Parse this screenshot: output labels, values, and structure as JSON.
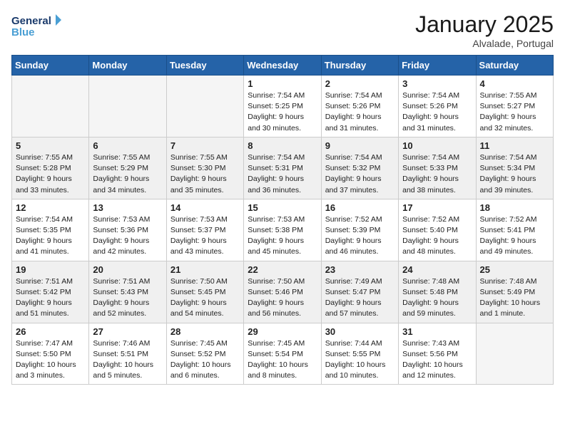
{
  "logo": {
    "line1": "General",
    "line2": "Blue"
  },
  "title": "January 2025",
  "location": "Alvalade, Portugal",
  "weekdays": [
    "Sunday",
    "Monday",
    "Tuesday",
    "Wednesday",
    "Thursday",
    "Friday",
    "Saturday"
  ],
  "weeks": [
    [
      {
        "day": "",
        "info": ""
      },
      {
        "day": "",
        "info": ""
      },
      {
        "day": "",
        "info": ""
      },
      {
        "day": "1",
        "info": "Sunrise: 7:54 AM\nSunset: 5:25 PM\nDaylight: 9 hours\nand 30 minutes."
      },
      {
        "day": "2",
        "info": "Sunrise: 7:54 AM\nSunset: 5:26 PM\nDaylight: 9 hours\nand 31 minutes."
      },
      {
        "day": "3",
        "info": "Sunrise: 7:54 AM\nSunset: 5:26 PM\nDaylight: 9 hours\nand 31 minutes."
      },
      {
        "day": "4",
        "info": "Sunrise: 7:55 AM\nSunset: 5:27 PM\nDaylight: 9 hours\nand 32 minutes."
      }
    ],
    [
      {
        "day": "5",
        "info": "Sunrise: 7:55 AM\nSunset: 5:28 PM\nDaylight: 9 hours\nand 33 minutes."
      },
      {
        "day": "6",
        "info": "Sunrise: 7:55 AM\nSunset: 5:29 PM\nDaylight: 9 hours\nand 34 minutes."
      },
      {
        "day": "7",
        "info": "Sunrise: 7:55 AM\nSunset: 5:30 PM\nDaylight: 9 hours\nand 35 minutes."
      },
      {
        "day": "8",
        "info": "Sunrise: 7:54 AM\nSunset: 5:31 PM\nDaylight: 9 hours\nand 36 minutes."
      },
      {
        "day": "9",
        "info": "Sunrise: 7:54 AM\nSunset: 5:32 PM\nDaylight: 9 hours\nand 37 minutes."
      },
      {
        "day": "10",
        "info": "Sunrise: 7:54 AM\nSunset: 5:33 PM\nDaylight: 9 hours\nand 38 minutes."
      },
      {
        "day": "11",
        "info": "Sunrise: 7:54 AM\nSunset: 5:34 PM\nDaylight: 9 hours\nand 39 minutes."
      }
    ],
    [
      {
        "day": "12",
        "info": "Sunrise: 7:54 AM\nSunset: 5:35 PM\nDaylight: 9 hours\nand 41 minutes."
      },
      {
        "day": "13",
        "info": "Sunrise: 7:53 AM\nSunset: 5:36 PM\nDaylight: 9 hours\nand 42 minutes."
      },
      {
        "day": "14",
        "info": "Sunrise: 7:53 AM\nSunset: 5:37 PM\nDaylight: 9 hours\nand 43 minutes."
      },
      {
        "day": "15",
        "info": "Sunrise: 7:53 AM\nSunset: 5:38 PM\nDaylight: 9 hours\nand 45 minutes."
      },
      {
        "day": "16",
        "info": "Sunrise: 7:52 AM\nSunset: 5:39 PM\nDaylight: 9 hours\nand 46 minutes."
      },
      {
        "day": "17",
        "info": "Sunrise: 7:52 AM\nSunset: 5:40 PM\nDaylight: 9 hours\nand 48 minutes."
      },
      {
        "day": "18",
        "info": "Sunrise: 7:52 AM\nSunset: 5:41 PM\nDaylight: 9 hours\nand 49 minutes."
      }
    ],
    [
      {
        "day": "19",
        "info": "Sunrise: 7:51 AM\nSunset: 5:42 PM\nDaylight: 9 hours\nand 51 minutes."
      },
      {
        "day": "20",
        "info": "Sunrise: 7:51 AM\nSunset: 5:43 PM\nDaylight: 9 hours\nand 52 minutes."
      },
      {
        "day": "21",
        "info": "Sunrise: 7:50 AM\nSunset: 5:45 PM\nDaylight: 9 hours\nand 54 minutes."
      },
      {
        "day": "22",
        "info": "Sunrise: 7:50 AM\nSunset: 5:46 PM\nDaylight: 9 hours\nand 56 minutes."
      },
      {
        "day": "23",
        "info": "Sunrise: 7:49 AM\nSunset: 5:47 PM\nDaylight: 9 hours\nand 57 minutes."
      },
      {
        "day": "24",
        "info": "Sunrise: 7:48 AM\nSunset: 5:48 PM\nDaylight: 9 hours\nand 59 minutes."
      },
      {
        "day": "25",
        "info": "Sunrise: 7:48 AM\nSunset: 5:49 PM\nDaylight: 10 hours\nand 1 minute."
      }
    ],
    [
      {
        "day": "26",
        "info": "Sunrise: 7:47 AM\nSunset: 5:50 PM\nDaylight: 10 hours\nand 3 minutes."
      },
      {
        "day": "27",
        "info": "Sunrise: 7:46 AM\nSunset: 5:51 PM\nDaylight: 10 hours\nand 5 minutes."
      },
      {
        "day": "28",
        "info": "Sunrise: 7:45 AM\nSunset: 5:52 PM\nDaylight: 10 hours\nand 6 minutes."
      },
      {
        "day": "29",
        "info": "Sunrise: 7:45 AM\nSunset: 5:54 PM\nDaylight: 10 hours\nand 8 minutes."
      },
      {
        "day": "30",
        "info": "Sunrise: 7:44 AM\nSunset: 5:55 PM\nDaylight: 10 hours\nand 10 minutes."
      },
      {
        "day": "31",
        "info": "Sunrise: 7:43 AM\nSunset: 5:56 PM\nDaylight: 10 hours\nand 12 minutes."
      },
      {
        "day": "",
        "info": ""
      }
    ]
  ]
}
